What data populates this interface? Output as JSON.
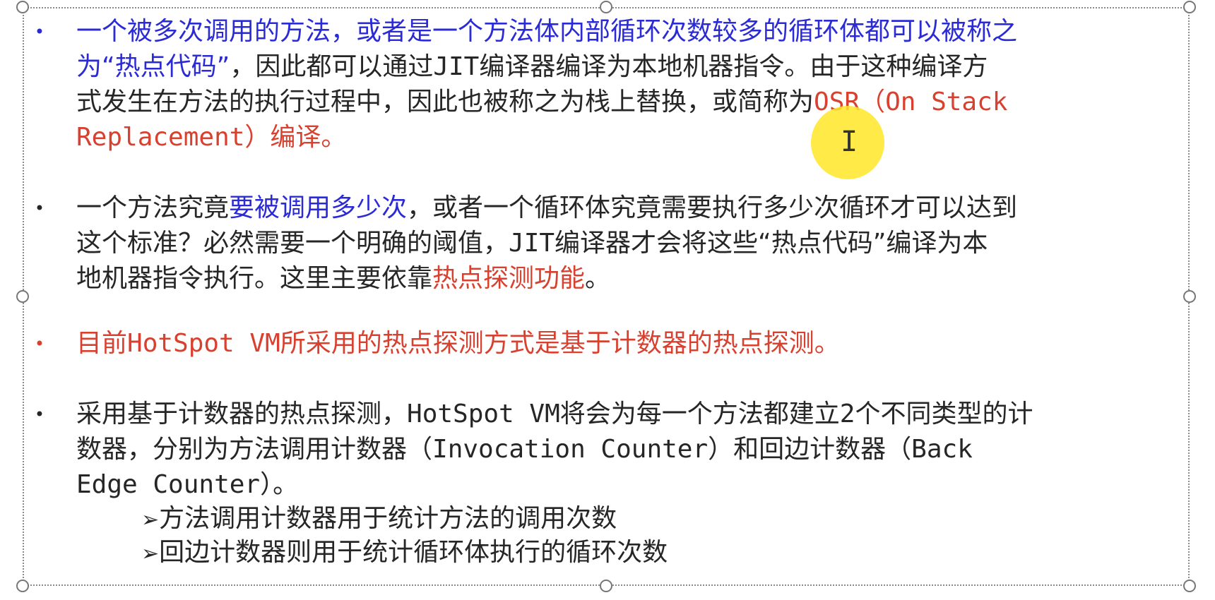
{
  "items": [
    {
      "lines": [
        [
          {
            "t": "一个被多次调用的方法，或者是一个方法体内部循环次数较多的循环体都可以被称之",
            "c": "blue"
          }
        ],
        [
          {
            "t": "为“热点代码”",
            "c": "blue"
          },
          {
            "t": "，因此都可以通过JIT编译器编译为本地机器指令。由于这种编译方",
            "c": ""
          }
        ],
        [
          {
            "t": "式发生在方法的执行过程中，因此也被称之为栈上替换，或简称为",
            "c": ""
          },
          {
            "t": "OSR（On Stack",
            "c": "red"
          }
        ],
        [
          {
            "t": "Replacement）编译。",
            "c": "red"
          }
        ]
      ]
    },
    {
      "lines": [
        [
          {
            "t": "一个方法究竟",
            "c": ""
          },
          {
            "t": "要被调用多少次",
            "c": "blue"
          },
          {
            "t": "，或者一个循环体究竟需要执行多少次循环才可以达到",
            "c": ""
          }
        ],
        [
          {
            "t": "这个标准？必然需要一个明确的阈值，JIT编译器才会将这些“热点代码”编译为本",
            "c": ""
          }
        ],
        [
          {
            "t": "地机器指令执行。这里主要依靠",
            "c": ""
          },
          {
            "t": "热点探测功能",
            "c": "red"
          },
          {
            "t": "。",
            "c": ""
          }
        ]
      ]
    },
    {
      "lines": [
        [
          {
            "t": "目前HotSpot VM所采用的热点探测方式是基于计数器的热点探测。",
            "c": "red"
          }
        ]
      ]
    },
    {
      "lines": [
        [
          {
            "t": "采用基于计数器的热点探测，HotSpot VM将会为每一个方法都建立2个不同类型的计",
            "c": ""
          }
        ],
        [
          {
            "t": "数器，分别为方法调用计数器（Invocation Counter）和回边计数器（Back",
            "c": ""
          }
        ],
        [
          {
            "t": "Edge Counter）。",
            "c": ""
          }
        ]
      ]
    }
  ],
  "sub_items": [
    {
      "arrow": "➢",
      "text": "方法调用计数器用于统计方法的调用次数"
    },
    {
      "arrow": "➢",
      "text": "回边计数器则用于统计循环体执行的循环次数"
    }
  ],
  "bullet_glyph": "•",
  "colors": {
    "blue": "#2b2bd6",
    "red": "#d8412f",
    "text": "#262626"
  }
}
